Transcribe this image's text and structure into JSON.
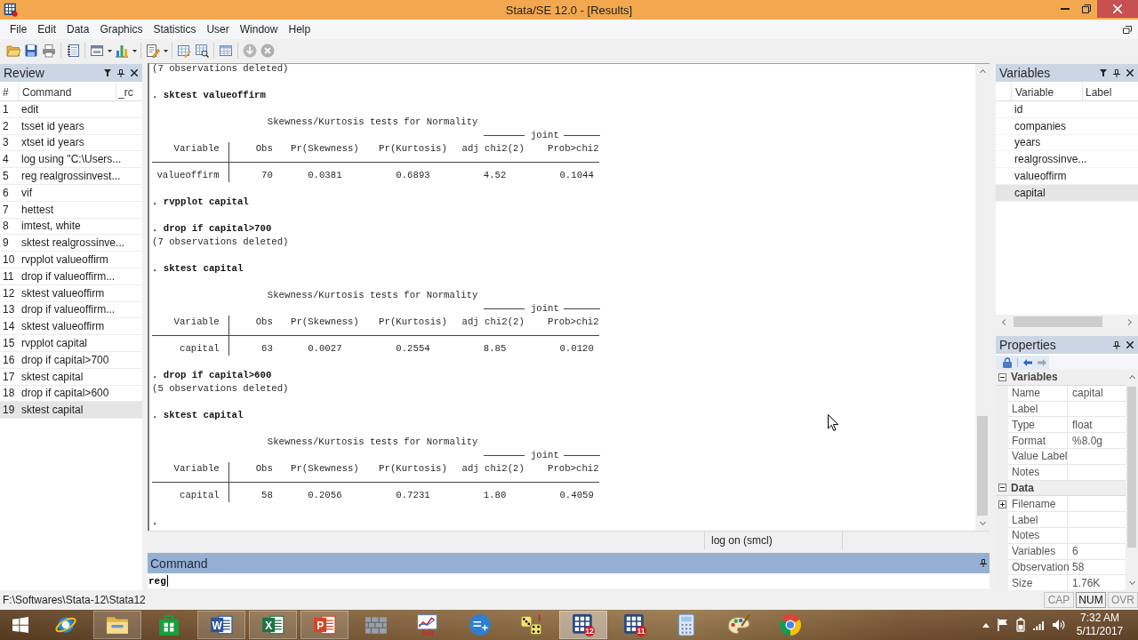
{
  "window": {
    "title": "Stata/SE 12.0 - [Results]"
  },
  "menu": [
    "File",
    "Edit",
    "Data",
    "Graphics",
    "Statistics",
    "User",
    "Window",
    "Help"
  ],
  "toolbar": [
    {
      "disabled": false,
      "dropdown": false
    },
    {
      "disabled": false,
      "dropdown": false
    },
    {
      "disabled": false,
      "dropdown": false
    },
    {
      "disabled": false,
      "dropdown": false
    },
    {
      "disabled": false,
      "dropdown": true
    },
    {
      "disabled": false,
      "dropdown": true
    },
    {
      "disabled": false,
      "dropdown": true
    },
    {
      "disabled": false,
      "dropdown": false
    },
    {
      "disabled": false,
      "dropdown": false
    },
    {
      "disabled": false,
      "dropdown": false
    },
    {
      "disabled": true,
      "dropdown": false
    },
    {
      "disabled": true,
      "dropdown": false
    }
  ],
  "review": {
    "title": "Review",
    "columns": [
      "#",
      "Command",
      "_rc"
    ],
    "rows": [
      {
        "number": "1",
        "command": "edit",
        "selected": false
      },
      {
        "number": "2",
        "command": "tsset id years",
        "selected": false
      },
      {
        "number": "3",
        "command": "xtset id years",
        "selected": false
      },
      {
        "number": "4",
        "command": "log using \"C:\\Users...",
        "selected": false
      },
      {
        "number": "5",
        "command": "reg realgrossinvest...",
        "selected": false
      },
      {
        "number": "6",
        "command": "vif",
        "selected": false
      },
      {
        "number": "7",
        "command": "hettest",
        "selected": false
      },
      {
        "number": "8",
        "command": "imtest, white",
        "selected": false
      },
      {
        "number": "9",
        "command": "sktest realgrossinve...",
        "selected": false
      },
      {
        "number": "10",
        "command": "rvpplot valueoffirm",
        "selected": false
      },
      {
        "number": "11",
        "command": "drop if valueoffirm...",
        "selected": false
      },
      {
        "number": "12",
        "command": "sktest valueoffirm",
        "selected": false
      },
      {
        "number": "13",
        "command": "drop if valueoffirm...",
        "selected": false
      },
      {
        "number": "14",
        "command": "sktest valueoffirm",
        "selected": false
      },
      {
        "number": "15",
        "command": "rvpplot capital",
        "selected": false
      },
      {
        "number": "16",
        "command": "drop if capital>700",
        "selected": false
      },
      {
        "number": "17",
        "command": "sktest capital",
        "selected": false
      },
      {
        "number": "18",
        "command": "drop if capital>600",
        "selected": false
      },
      {
        "number": "19",
        "command": "sktest capital",
        "selected": true
      }
    ]
  },
  "results": {
    "blocks": [
      {
        "kind": "output",
        "text": "(7 observations deleted)"
      },
      {
        "kind": "command",
        "text": ". sktest valueoffirm"
      },
      {
        "kind": "table",
        "title": "Skewness/Kurtosis tests for Normality",
        "group": "joint",
        "columns": [
          "Variable",
          "Obs",
          "Pr(Skewness)",
          "Pr(Kurtosis)",
          "adj chi2(2)",
          "Prob>chi2"
        ],
        "rows": [
          [
            "valueoffirm",
            "70",
            "0.0381",
            "0.6893",
            "4.52",
            "0.1044"
          ]
        ]
      },
      {
        "kind": "command",
        "text": ". rvpplot capital"
      },
      {
        "kind": "command",
        "text": ". drop if capital>700"
      },
      {
        "kind": "output",
        "text": "(7 observations deleted)"
      },
      {
        "kind": "command",
        "text": ". sktest capital"
      },
      {
        "kind": "table",
        "title": "Skewness/Kurtosis tests for Normality",
        "group": "joint",
        "columns": [
          "Variable",
          "Obs",
          "Pr(Skewness)",
          "Pr(Kurtosis)",
          "adj chi2(2)",
          "Prob>chi2"
        ],
        "rows": [
          [
            "capital",
            "63",
            "0.0027",
            "0.2554",
            "8.85",
            "0.0120"
          ]
        ]
      },
      {
        "kind": "command",
        "text": ". drop if capital>600"
      },
      {
        "kind": "output",
        "text": "(5 observations deleted)"
      },
      {
        "kind": "command",
        "text": ". sktest capital"
      },
      {
        "kind": "table",
        "title": "Skewness/Kurtosis tests for Normality",
        "group": "joint",
        "columns": [
          "Variable",
          "Obs",
          "Pr(Skewness)",
          "Pr(Kurtosis)",
          "adj chi2(2)",
          "Prob>chi2"
        ],
        "rows": [
          [
            "capital",
            "58",
            "0.2056",
            "0.7231",
            "1.80",
            "0.4059"
          ]
        ]
      },
      {
        "kind": "prompt",
        "text": "."
      }
    ],
    "log_status": "log on (smcl)"
  },
  "command": {
    "title": "Command",
    "value": "reg"
  },
  "variables": {
    "title": "Variables",
    "columns": [
      "Variable",
      "Label"
    ],
    "rows": [
      {
        "name": "id",
        "selected": false
      },
      {
        "name": "companies",
        "selected": false
      },
      {
        "name": "years",
        "selected": false
      },
      {
        "name": "realgrossinve...",
        "selected": false
      },
      {
        "name": "valueoffirm",
        "selected": false
      },
      {
        "name": "capital",
        "selected": true
      }
    ]
  },
  "properties": {
    "title": "Properties",
    "toolbar": [
      {
        "disabled": false
      },
      {
        "disabled": false
      },
      {
        "disabled": true
      }
    ],
    "sections": [
      {
        "title": "Variables",
        "expanded": true,
        "rows": [
          {
            "name": "Name",
            "value": "capital",
            "expandable": false
          },
          {
            "name": "Label",
            "expandable": false
          },
          {
            "name": "Type",
            "value": "float",
            "expandable": false
          },
          {
            "name": "Format",
            "value": "%8.0g",
            "expandable": false
          },
          {
            "name": "Value Label",
            "expandable": false
          },
          {
            "name": "Notes",
            "expandable": false
          }
        ]
      },
      {
        "title": "Data",
        "expanded": true,
        "rows": [
          {
            "name": "Filename",
            "expandable": true
          },
          {
            "name": "Label",
            "expandable": false
          },
          {
            "name": "Notes",
            "expandable": false
          },
          {
            "name": "Variables",
            "value": "6",
            "expandable": false
          },
          {
            "name": "Observation",
            "value": "58",
            "expandable": false
          },
          {
            "name": "Size",
            "value": "1.76K",
            "expandable": false
          }
        ]
      }
    ]
  },
  "status_bar": {
    "path": "F:\\Softwares\\Stata-12\\Stata12",
    "indicators": [
      {
        "label": "CAP",
        "on": false
      },
      {
        "label": "NUM",
        "on": true
      },
      {
        "label": "OVR",
        "on": false
      }
    ]
  },
  "taskbar": {
    "apps": [
      {
        "open": false,
        "active": false
      },
      {
        "open": true,
        "active": false
      },
      {
        "open": false,
        "active": false
      },
      {
        "open": true,
        "active": false,
        "letter": "W"
      },
      {
        "open": true,
        "active": false,
        "letter": "X"
      },
      {
        "open": true,
        "active": false,
        "letter": "P"
      },
      {
        "open": false,
        "active": false
      },
      {
        "open": false,
        "active": false
      },
      {
        "open": false,
        "active": false
      },
      {
        "open": false,
        "active": false
      },
      {
        "open": true,
        "active": true,
        "badge": "12"
      },
      {
        "open": false,
        "active": false,
        "badge": "11"
      },
      {
        "open": false,
        "active": false
      },
      {
        "open": false,
        "active": false
      },
      {
        "open": false,
        "active": false
      }
    ],
    "clock": {
      "time": "7:32 AM",
      "date": "5/11/2017"
    }
  }
}
